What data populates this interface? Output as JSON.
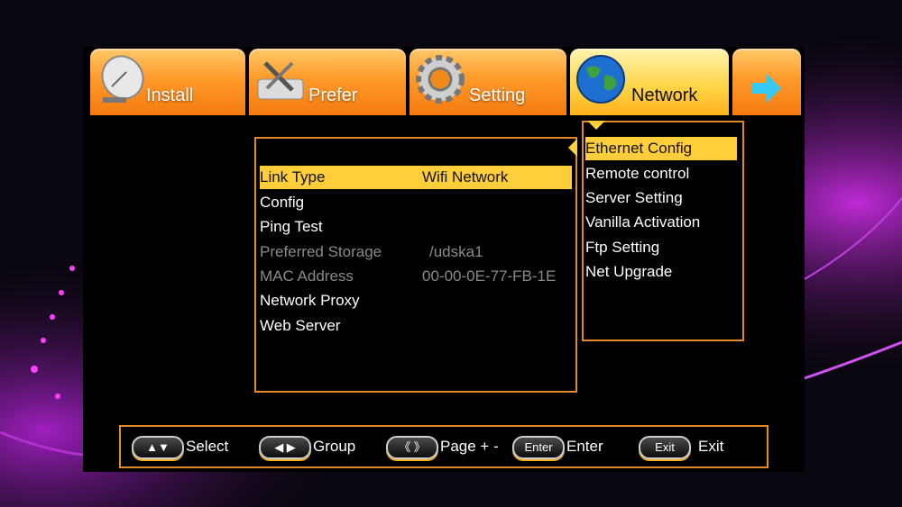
{
  "tabs": [
    {
      "label": "Install",
      "icon": "satellite-dish-icon"
    },
    {
      "label": "Prefer",
      "icon": "tools-icon"
    },
    {
      "label": "Setting",
      "icon": "gear-icon"
    },
    {
      "label": "Network",
      "icon": "globe-icon",
      "active": true
    },
    {
      "label": "",
      "icon": "arrow-right-icon"
    }
  ],
  "network_settings": [
    {
      "label": "Link Type",
      "value": "Wifi Network",
      "selected": true
    },
    {
      "label": "Config",
      "value": ""
    },
    {
      "label": "Ping Test",
      "value": ""
    },
    {
      "label": "Preferred Storage",
      "value": "/udska1",
      "disabled": true
    },
    {
      "label": "MAC Address",
      "value": "00-00-0E-77-FB-1E",
      "disabled": true
    },
    {
      "label": "Network Proxy",
      "value": ""
    },
    {
      "label": "Web Server",
      "value": ""
    }
  ],
  "submenu": [
    {
      "label": "Ethernet Config",
      "selected": true
    },
    {
      "label": "Remote control"
    },
    {
      "label": "Server Setting"
    },
    {
      "label": "Vanilla Activation"
    },
    {
      "label": "Ftp Setting"
    },
    {
      "label": "Net Upgrade"
    }
  ],
  "footer": {
    "select": {
      "key": "▲▼",
      "label": "Select"
    },
    "group": {
      "key": "◀ ▶",
      "label": "Group"
    },
    "page": {
      "key": "《 》",
      "label": "Page + -"
    },
    "enter": {
      "key": "Enter",
      "label": "Enter"
    },
    "exit": {
      "key": "Exit",
      "label": "Exit"
    }
  },
  "colors": {
    "accent": "#e08a2a",
    "tab": "#ff9a2a",
    "tab_active": "#ffd64a",
    "selection": "#ffce3a"
  }
}
